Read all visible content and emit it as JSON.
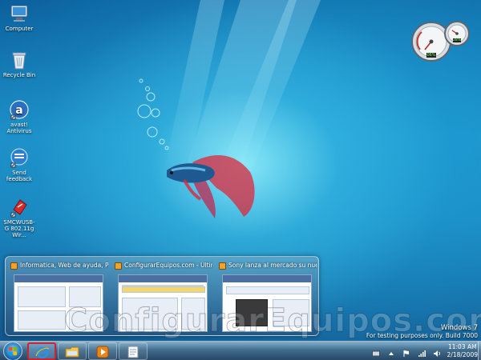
{
  "desktop_icons": [
    {
      "id": "computer",
      "label": "Computer",
      "icon": "computer-icon"
    },
    {
      "id": "recycle-bin",
      "label": "Recycle Bin",
      "icon": "recycle-bin-icon"
    },
    {
      "id": "avast",
      "label": "avast! Antivirus",
      "icon": "avast-icon"
    },
    {
      "id": "feedback",
      "label": "Send feedback",
      "icon": "feedback-icon"
    },
    {
      "id": "smcwusb",
      "label": "SMCWUSB-G 802.11g Wir...",
      "icon": "usb-adapter-icon"
    }
  ],
  "gadget": {
    "name": "cpu-meter",
    "cpu_percent": "06%",
    "memory_percent": "28%"
  },
  "previews": [
    {
      "title": "Informatica, Web de ayuda, Pro...",
      "icon": "browser-tab-icon"
    },
    {
      "title": "ConfigurarEquipos.com - Últim...",
      "icon": "browser-tab-icon"
    },
    {
      "title": "Sony lanza al mercado su nueva...",
      "icon": "browser-tab-icon"
    }
  ],
  "watermark": "ConfigurarEquipos.com",
  "build": {
    "os": "Windows 7",
    "note": "For testing purposes only. Build 7000"
  },
  "taskbar": {
    "items": [
      {
        "name": "internet-explorer",
        "active": true
      },
      {
        "name": "windows-explorer",
        "active": false
      },
      {
        "name": "media-player",
        "active": false
      },
      {
        "name": "notepad",
        "active": false
      }
    ],
    "clock": {
      "time": "11:03 AM",
      "date": "2/18/2009"
    }
  },
  "colors": {
    "accent_active": "#d1232a",
    "preview_fav": "#f0a22b"
  }
}
